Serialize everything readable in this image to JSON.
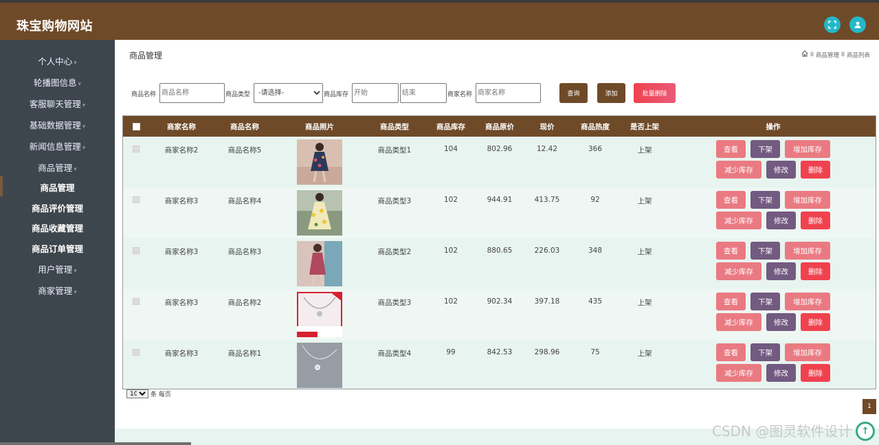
{
  "app": {
    "title": "珠宝购物网站"
  },
  "header": {
    "fullscreen_icon": "expand-icon",
    "user_icon": "user-icon"
  },
  "sidebar": {
    "items": [
      {
        "label": "个人中心",
        "type": "menu"
      },
      {
        "label": "轮播图信息",
        "type": "menu"
      },
      {
        "label": "客服聊天管理",
        "type": "menu"
      },
      {
        "label": "基础数据管理",
        "type": "menu"
      },
      {
        "label": "新闻信息管理",
        "type": "menu"
      },
      {
        "label": "商品管理",
        "type": "menu"
      },
      {
        "label": "商品管理",
        "type": "sub",
        "active": true
      },
      {
        "label": "商品评价管理",
        "type": "sub"
      },
      {
        "label": "商品收藏管理",
        "type": "sub"
      },
      {
        "label": "商品订单管理",
        "type": "sub"
      },
      {
        "label": "用户管理",
        "type": "menu"
      },
      {
        "label": "商家管理",
        "type": "menu"
      }
    ]
  },
  "page": {
    "title": "商品管理",
    "breadcrumb": [
      "商品管理",
      "商品列表"
    ],
    "breadcrumb_sep": "II"
  },
  "filters": {
    "name_label": "商品名称",
    "name_placeholder": "商品名称",
    "type_label": "商品类型",
    "type_value": "-请选择-",
    "stock_label": "商品库存",
    "stock_start_placeholder": "开始",
    "stock_end_placeholder": "结束",
    "merchant_label": "商家名称",
    "merchant_placeholder": "商家名称",
    "search_label": "查询",
    "add_label": "添加",
    "batch_delete_label": "批量删除"
  },
  "table": {
    "headers": [
      "商家名称",
      "商品名称",
      "商品照片",
      "商品类型",
      "商品库存",
      "商品原价",
      "现价",
      "商品热度",
      "是否上架",
      "操作"
    ],
    "action_labels": {
      "view": "查看",
      "off_shelf": "下架",
      "add_stock": "增加库存",
      "reduce_stock": "减少库存",
      "edit": "修改",
      "delete": "删除"
    },
    "rows": [
      {
        "merchant": "商家名称2",
        "name": "商品名称5",
        "type": "商品类型1",
        "stock": "104",
        "original": "802.96",
        "price": "12.42",
        "heat": "366",
        "status": "上架",
        "photo": "dress-floral-dark"
      },
      {
        "merchant": "商家名称3",
        "name": "商品名称4",
        "type": "商品类型3",
        "stock": "102",
        "original": "944.91",
        "price": "413.75",
        "heat": "92",
        "status": "上架",
        "photo": "dress-yellow-floral"
      },
      {
        "merchant": "商家名称3",
        "name": "商品名称3",
        "type": "商品类型2",
        "stock": "102",
        "original": "880.65",
        "price": "226.03",
        "heat": "348",
        "status": "上架",
        "photo": "dress-pink"
      },
      {
        "merchant": "商家名称3",
        "name": "商品名称2",
        "type": "商品类型3",
        "stock": "102",
        "original": "902.34",
        "price": "397.18",
        "heat": "435",
        "status": "上架",
        "photo": "necklace-red-promo"
      },
      {
        "merchant": "商家名称3",
        "name": "商品名称1",
        "type": "商品类型4",
        "stock": "99",
        "original": "842.53",
        "price": "298.96",
        "heat": "75",
        "status": "上架",
        "photo": "necklace-grey"
      }
    ]
  },
  "pagination": {
    "page_size": "10",
    "page_size_suffix": "条 每页",
    "current_page": "1"
  },
  "watermark": "CSDN @图灵软件设计",
  "colors": {
    "brand": "#6f4a28",
    "sidebar": "#3e464d",
    "row_alt": "#e8f4ef",
    "danger": "#f0424e",
    "pink": "#ea7a82",
    "purple": "#735a80",
    "cyan": "#23b8c9"
  }
}
